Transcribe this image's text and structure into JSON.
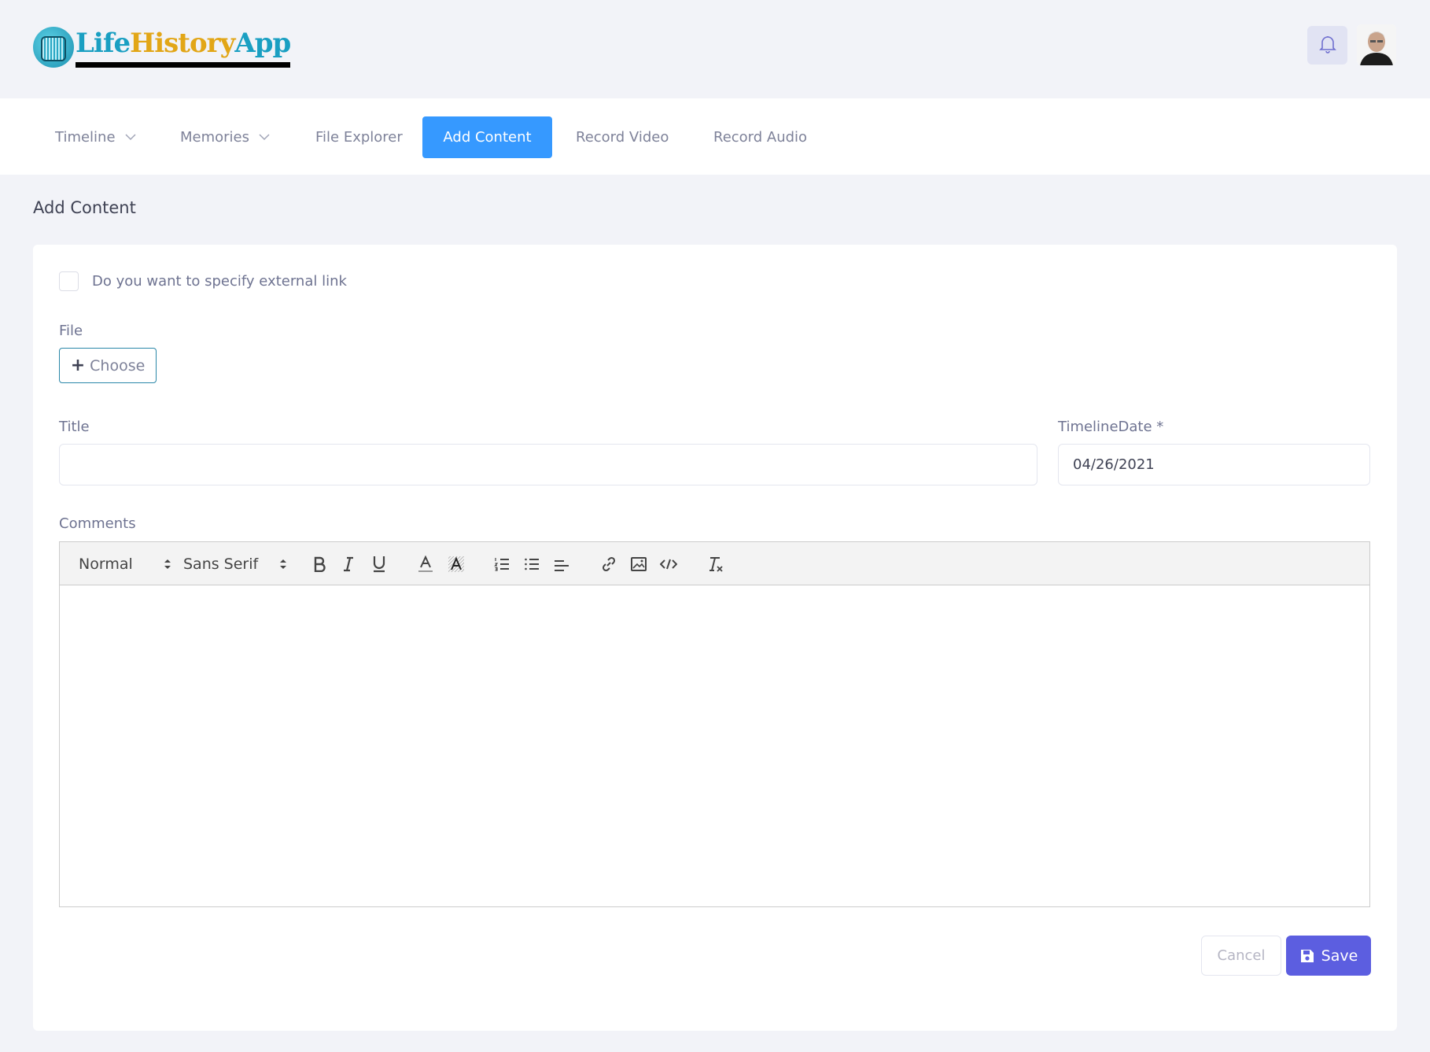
{
  "brand": {
    "logo_part1": "Life",
    "logo_part2": "History",
    "logo_part3": "App"
  },
  "header": {
    "notifications_icon": "bell-icon",
    "avatar_icon": "user-avatar"
  },
  "nav": {
    "items": [
      {
        "label": "Timeline",
        "has_dropdown": true
      },
      {
        "label": "Memories",
        "has_dropdown": true
      },
      {
        "label": "File Explorer",
        "has_dropdown": false
      },
      {
        "label": "Add Content",
        "has_dropdown": false,
        "active": true
      },
      {
        "label": "Record Video",
        "has_dropdown": false
      },
      {
        "label": "Record Audio",
        "has_dropdown": false
      }
    ]
  },
  "page": {
    "title": "Add Content"
  },
  "form": {
    "external_link_label": "Do you want to specify external link",
    "external_link_checked": false,
    "file_label": "File",
    "choose_label": "Choose",
    "title_label": "Title",
    "title_value": "",
    "timeline_date_label": "TimelineDate *",
    "timeline_date_value": "04/26/2021",
    "comments_label": "Comments",
    "toolbar": {
      "header_select": "Normal",
      "font_select": "Sans Serif"
    },
    "cancel_label": "Cancel",
    "save_label": "Save"
  },
  "colors": {
    "accent": "#3699ff",
    "save": "#5c5ee0",
    "page_bg": "#f2f3f8"
  }
}
